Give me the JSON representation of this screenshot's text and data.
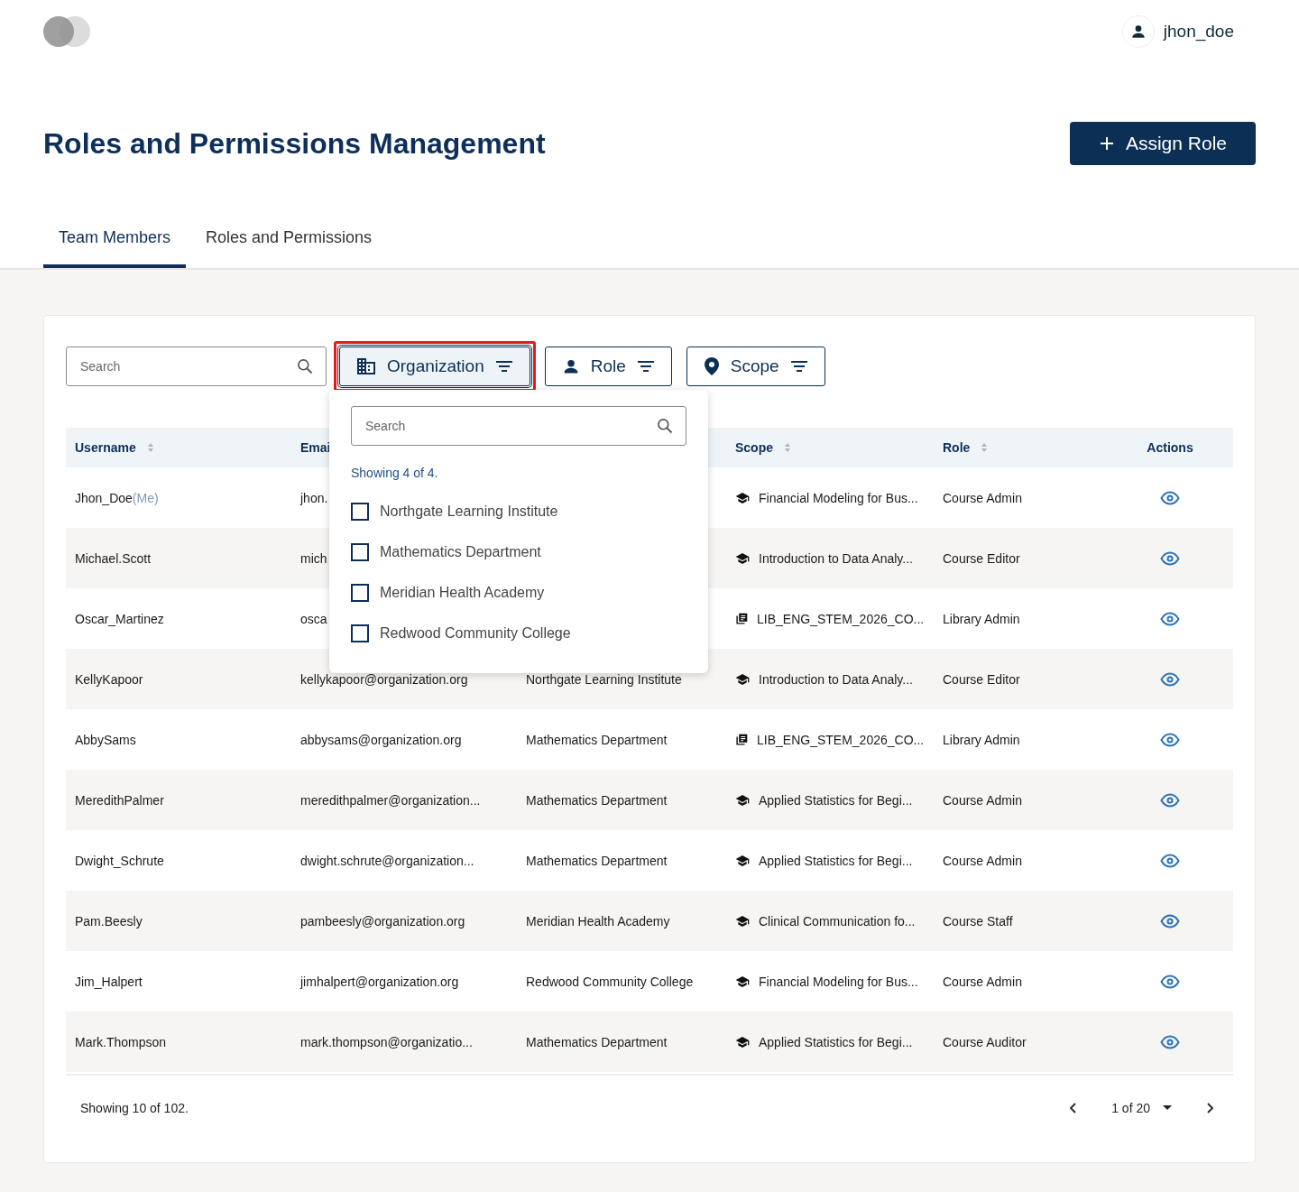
{
  "header": {
    "username": "jhon_doe"
  },
  "page": {
    "title": "Roles and Permissions Management",
    "primary_button": "Assign Role"
  },
  "tabs": [
    {
      "label": "Team Members",
      "selected": true
    },
    {
      "label": "Roles and Permissions",
      "selected": false
    }
  ],
  "search": {
    "placeholder": "Search"
  },
  "filters": [
    {
      "kind": "organization",
      "label": "Organization",
      "open": true,
      "highlighted": true
    },
    {
      "kind": "role",
      "label": "Role",
      "open": false,
      "highlighted": false
    },
    {
      "kind": "scope",
      "label": "Scope",
      "open": false,
      "highlighted": false
    }
  ],
  "dropdown": {
    "search_placeholder": "Search",
    "count": "Showing 4 of 4.",
    "options": [
      {
        "label": "Northgate Learning Institute",
        "checked": false
      },
      {
        "label": "Mathematics Department",
        "checked": false
      },
      {
        "label": "Meridian Health Academy",
        "checked": false
      },
      {
        "label": "Redwood Community College",
        "checked": false
      }
    ]
  },
  "table": {
    "columns": [
      {
        "label": "Username",
        "sortable": true
      },
      {
        "label": "Emai"
      },
      {},
      {
        "label": "Scope",
        "sortable": true
      },
      {
        "label": "Role",
        "sortable": true
      },
      {
        "label": "Actions",
        "sortable": false
      }
    ],
    "rows": [
      {
        "username": "Jhon_Doe",
        "me": "(Me)",
        "email": "jhon.",
        "scope": {
          "kind": "course",
          "text": "Financial Modeling for Bus..."
        },
        "role": "Course Admin"
      },
      {
        "username": "Michael.Scott",
        "email": "mich",
        "scope": {
          "kind": "course",
          "text": "Introduction to Data Analy..."
        },
        "role": "Course Editor"
      },
      {
        "username": "Oscar_Martinez",
        "email": "osca",
        "scope": {
          "kind": "library",
          "text": "LIB_ENG_STEM_2026_CO..."
        },
        "role": "Library Admin"
      },
      {
        "username": "KellyKapoor",
        "email": "kellykapoor@organization.org",
        "organization": "Northgate Learning Institute",
        "scope": {
          "kind": "course",
          "text": "Introduction to Data Analy..."
        },
        "role": "Course Editor"
      },
      {
        "username": "AbbySams",
        "email": "abbysams@organization.org",
        "organization": "Mathematics Department",
        "scope": {
          "kind": "library",
          "text": "LIB_ENG_STEM_2026_CO..."
        },
        "role": "Library Admin"
      },
      {
        "username": "MeredithPalmer",
        "email": "meredithpalmer@organization...",
        "organization": "Mathematics Department",
        "scope": {
          "kind": "course",
          "text": "Applied Statistics for Begi..."
        },
        "role": "Course Admin"
      },
      {
        "username": "Dwight_Schrute",
        "email": "dwight.schrute@organization...",
        "organization": "Mathematics Department",
        "scope": {
          "kind": "course",
          "text": "Applied Statistics for Begi..."
        },
        "role": "Course Admin"
      },
      {
        "username": "Pam.Beesly",
        "email": "pambeesly@organization.org",
        "organization": "Meridian Health Academy",
        "scope": {
          "kind": "course",
          "text": "Clinical Communication fo..."
        },
        "role": "Course Staff"
      },
      {
        "username": "Jim_Halpert",
        "email": "jimhalpert@organization.org",
        "organization": "Redwood Community College",
        "scope": {
          "kind": "course",
          "text": "Financial Modeling for Bus..."
        },
        "role": "Course Admin"
      },
      {
        "username": "Mark.Thompson",
        "email": "mark.thompson@organizatio...",
        "organization": "Mathematics Department",
        "scope": {
          "kind": "course",
          "text": "Applied Statistics for Begi..."
        },
        "role": "Course Auditor"
      }
    ]
  },
  "footer": {
    "count": "Showing 10 of 102.",
    "page": "1 of 20"
  }
}
